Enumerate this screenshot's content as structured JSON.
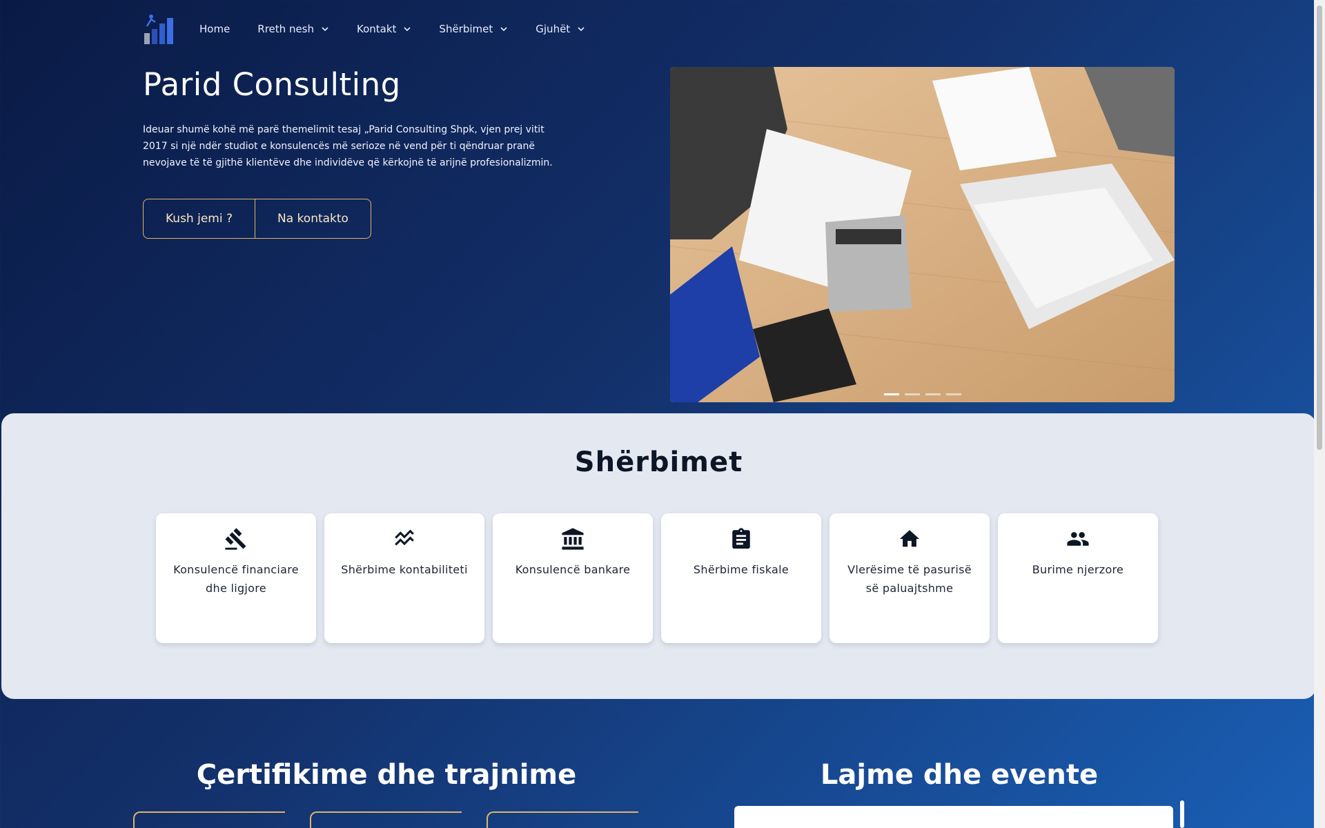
{
  "nav": {
    "items": [
      {
        "label": "Home",
        "has_dropdown": false
      },
      {
        "label": "Rreth nesh",
        "has_dropdown": true
      },
      {
        "label": "Kontakt",
        "has_dropdown": true
      },
      {
        "label": "Shërbimet",
        "has_dropdown": true
      },
      {
        "label": "Gjuhët",
        "has_dropdown": true
      }
    ]
  },
  "hero": {
    "title": "Parid Consulting",
    "description": "Ideuar shumë kohë më parë themelimit tesaj „Parid Consulting Shpk, vjen prej vitit 2017 si një ndër studiot e konsulencës më serioze në vend për ti qëndruar pranë nevojave të të gjithë klientëve dhe individëve që kërkojnë të arijnë profesionalizmin.",
    "button_left": "Kush jemi ?",
    "button_right": "Na kontakto",
    "carousel_slide_count": 4,
    "carousel_active_index": 0
  },
  "services": {
    "title": "Shërbimet",
    "cards": [
      {
        "label": "Konsulencë financiare dhe ligjore",
        "icon": "gavel-icon"
      },
      {
        "label": "Shërbime kontabiliteti",
        "icon": "chart-line-icon"
      },
      {
        "label": "Konsulencë bankare",
        "icon": "bank-icon"
      },
      {
        "label": "Shërbime fiskale",
        "icon": "clipboard-icon"
      },
      {
        "label": "Vlerësime të pasurisë së paluajtshme",
        "icon": "home-icon"
      },
      {
        "label": "Burime njerzore",
        "icon": "people-icon"
      }
    ]
  },
  "certifications": {
    "title": "Çertifikime dhe trajnime"
  },
  "news": {
    "title": "Lajme dhe evente"
  },
  "colors": {
    "accent_gold": "#e0b46a",
    "background_start": "#0a1a45",
    "background_end": "#1a5fb5",
    "services_bg": "#e3e8f1"
  }
}
